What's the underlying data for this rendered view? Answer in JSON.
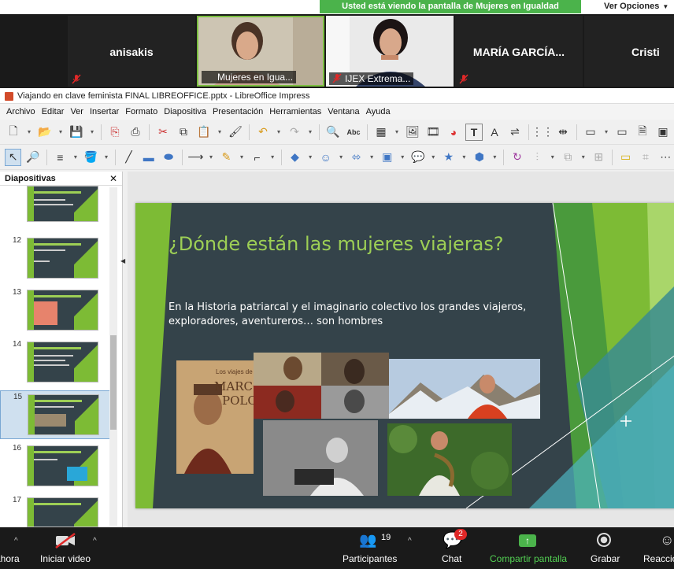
{
  "zoom": {
    "share_banner": "Usted está viendo la pantalla de Mujeres en Igualdad",
    "view_options": "Ver Opciones",
    "participants_tiles": [
      {
        "name": "anisakis",
        "muted": true
      },
      {
        "name": "Mujeres en Igua...",
        "muted": false
      },
      {
        "name": "IJEX Extrema...",
        "muted": true
      },
      {
        "name": "MARÍA GARCÍA...",
        "muted": true
      },
      {
        "name": "Cristi",
        "muted": false
      }
    ],
    "bottom": {
      "audio_label": "ahora",
      "video_label": "Iniciar video",
      "participants_label": "Participantes",
      "participants_count": "19",
      "chat_label": "Chat",
      "chat_badge": "2",
      "share_label": "Compartir pantalla",
      "record_label": "Grabar",
      "reactions_label": "Reaccio"
    },
    "colors": {
      "share_green": "#4bb34b",
      "share_text_green": "#53d153",
      "active_border": "#7bbf3f"
    }
  },
  "impress": {
    "window_title": "Viajando en clave feminista FINAL LIBREOFFICE.pptx - LibreOffice Impress",
    "menu": [
      "Archivo",
      "Editar",
      "Ver",
      "Insertar",
      "Formato",
      "Diapositiva",
      "Presentación",
      "Herramientas",
      "Ventana",
      "Ayuda"
    ],
    "slides_pane_title": "Diapositivas",
    "slide_numbers": [
      "12",
      "13",
      "14",
      "15",
      "16",
      "17"
    ],
    "selected_slide": "15",
    "slide": {
      "title": "¿Dónde están las mujeres viajeras?",
      "body": "En la Historia patriarcal y el imaginario colectivo los grandes viajeros, exploradores, aventureros… son hombres",
      "book_cover_line1": "Los viajes de",
      "book_cover_line2": "MARCO",
      "book_cover_line3": "POLO"
    },
    "colors": {
      "slide_bg": "#34434a",
      "accent_green": "#9dcf55",
      "lime": "#7dbb35",
      "teal": "#3a8c8f"
    }
  }
}
